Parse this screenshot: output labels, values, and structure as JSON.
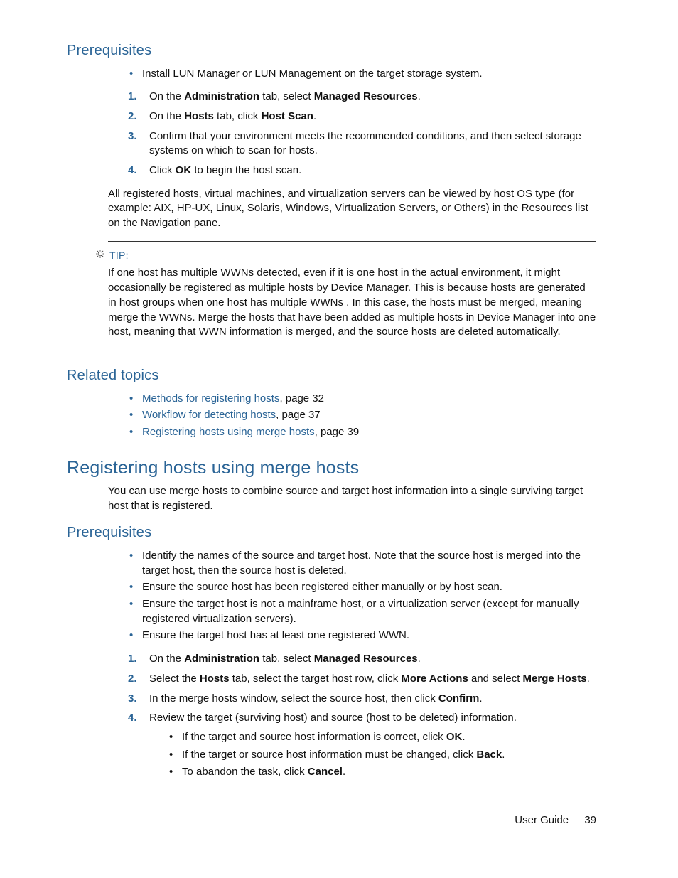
{
  "sections": {
    "prereq1_heading": "Prerequisites",
    "prereq1_bullet": "Install LUN Manager or LUN Management on the target storage system.",
    "step1_a": "On the ",
    "step1_b": "Administration",
    "step1_c": " tab, select ",
    "step1_d": "Managed Resources",
    "step1_e": ".",
    "step2_a": "On the ",
    "step2_b": "Hosts",
    "step2_c": " tab, click ",
    "step2_d": "Host Scan",
    "step2_e": ".",
    "step3": "Confirm that your environment meets the recommended conditions, and then select storage systems on which to scan for hosts.",
    "step4_a": "Click ",
    "step4_b": "OK",
    "step4_c": " to begin the host scan.",
    "para1": "All registered hosts, virtual machines, and virtualization servers can be viewed by host OS type (for example: AIX, HP-UX, Linux, Solaris, Windows, Virtualization Servers, or Others) in the Resources list on the Navigation pane.",
    "tip_label": "TIP:",
    "tip_text": "If one host has multiple WWNs detected, even if it is one host in the actual environment, it might occasionally be registered as multiple hosts by Device Manager. This is because hosts are generated in host groups when one host has multiple WWNs . In this case, the hosts must be merged, meaning merge the WWNs. Merge the hosts that have been added as multiple hosts in Device Manager into one host, meaning that WWN information is merged, and the source hosts are deleted automatically.",
    "related_heading": "Related topics",
    "rel1_link": "Methods for registering hosts",
    "rel1_suffix": ", page 32",
    "rel2_link": "Workflow for detecting hosts",
    "rel2_suffix": ", page 37",
    "rel3_link": "Registering hosts using merge hosts",
    "rel3_suffix": ", page 39",
    "h2_merge": "Registering hosts using merge hosts",
    "merge_intro": "You can use merge hosts to combine source and target host information into a single surviving target host that is registered.",
    "prereq2_heading": "Prerequisites",
    "p2_b1": "Identify the names of the source and target host. Note that the source host is merged into the target host, then the source host is deleted.",
    "p2_b2": "Ensure the source host has been registered either manually or by host scan.",
    "p2_b3": "Ensure the target host is not a mainframe host, or a virtualization server (except for manually registered virtualization servers).",
    "p2_b4": "Ensure the target host has at least one registered WWN.",
    "m1_a": "On the ",
    "m1_b": "Administration",
    "m1_c": " tab, select ",
    "m1_d": "Managed Resources",
    "m1_e": ".",
    "m2_a": "Select the ",
    "m2_b": "Hosts",
    "m2_c": " tab, select the target host row, click ",
    "m2_d": "More Actions",
    "m2_e": " and select ",
    "m2_f": "Merge Hosts",
    "m2_g": ".",
    "m3_a": "In the merge hosts window, select the source host, then click ",
    "m3_b": "Confirm",
    "m3_c": ".",
    "m4": "Review the target (surviving host) and source (host to be deleted) information.",
    "m4s1_a": "If the target and source host information is correct, click ",
    "m4s1_b": "OK",
    "m4s1_c": ".",
    "m4s2_a": "If the target or source host information must be changed, click ",
    "m4s2_b": "Back",
    "m4s2_c": ".",
    "m4s3_a": "To abandon the task, click ",
    "m4s3_b": "Cancel",
    "m4s3_c": "."
  },
  "footer": {
    "label": "User Guide",
    "page": "39"
  }
}
